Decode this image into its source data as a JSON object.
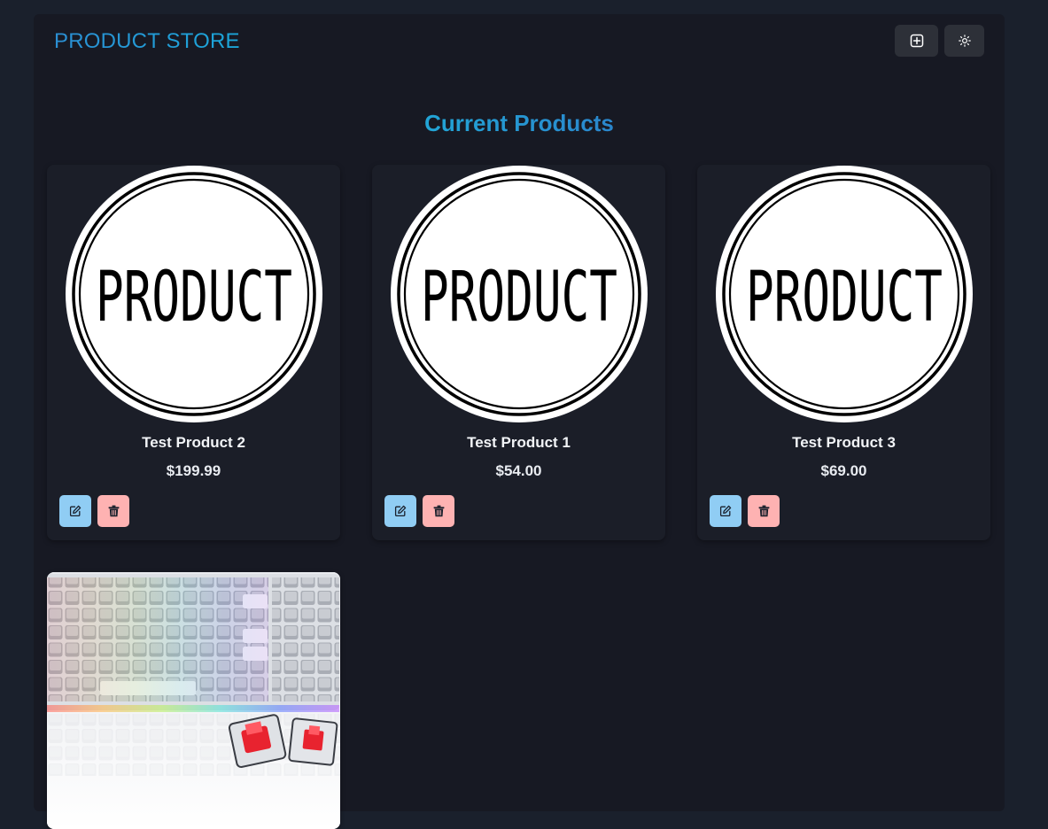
{
  "navbar": {
    "brand": "PRODUCT STORE",
    "add_icon": "plus-square-icon",
    "theme_icon": "sun-icon"
  },
  "main": {
    "title": "Current Products"
  },
  "products": [
    {
      "name": "Test Product 2",
      "price": "$199.99",
      "image_text": "PRODUCT"
    },
    {
      "name": "Test Product 1",
      "price": "$54.00",
      "image_text": "PRODUCT"
    },
    {
      "name": "Test Product 3",
      "price": "$69.00",
      "image_text": "PRODUCT"
    }
  ],
  "colors": {
    "background": "#1a202c",
    "container": "#171923",
    "accent": "#1ba6d9",
    "edit_button": "#90cdf4",
    "delete_button": "#feb2b2"
  },
  "icons": {
    "edit": "edit-icon",
    "delete": "trash-icon"
  }
}
